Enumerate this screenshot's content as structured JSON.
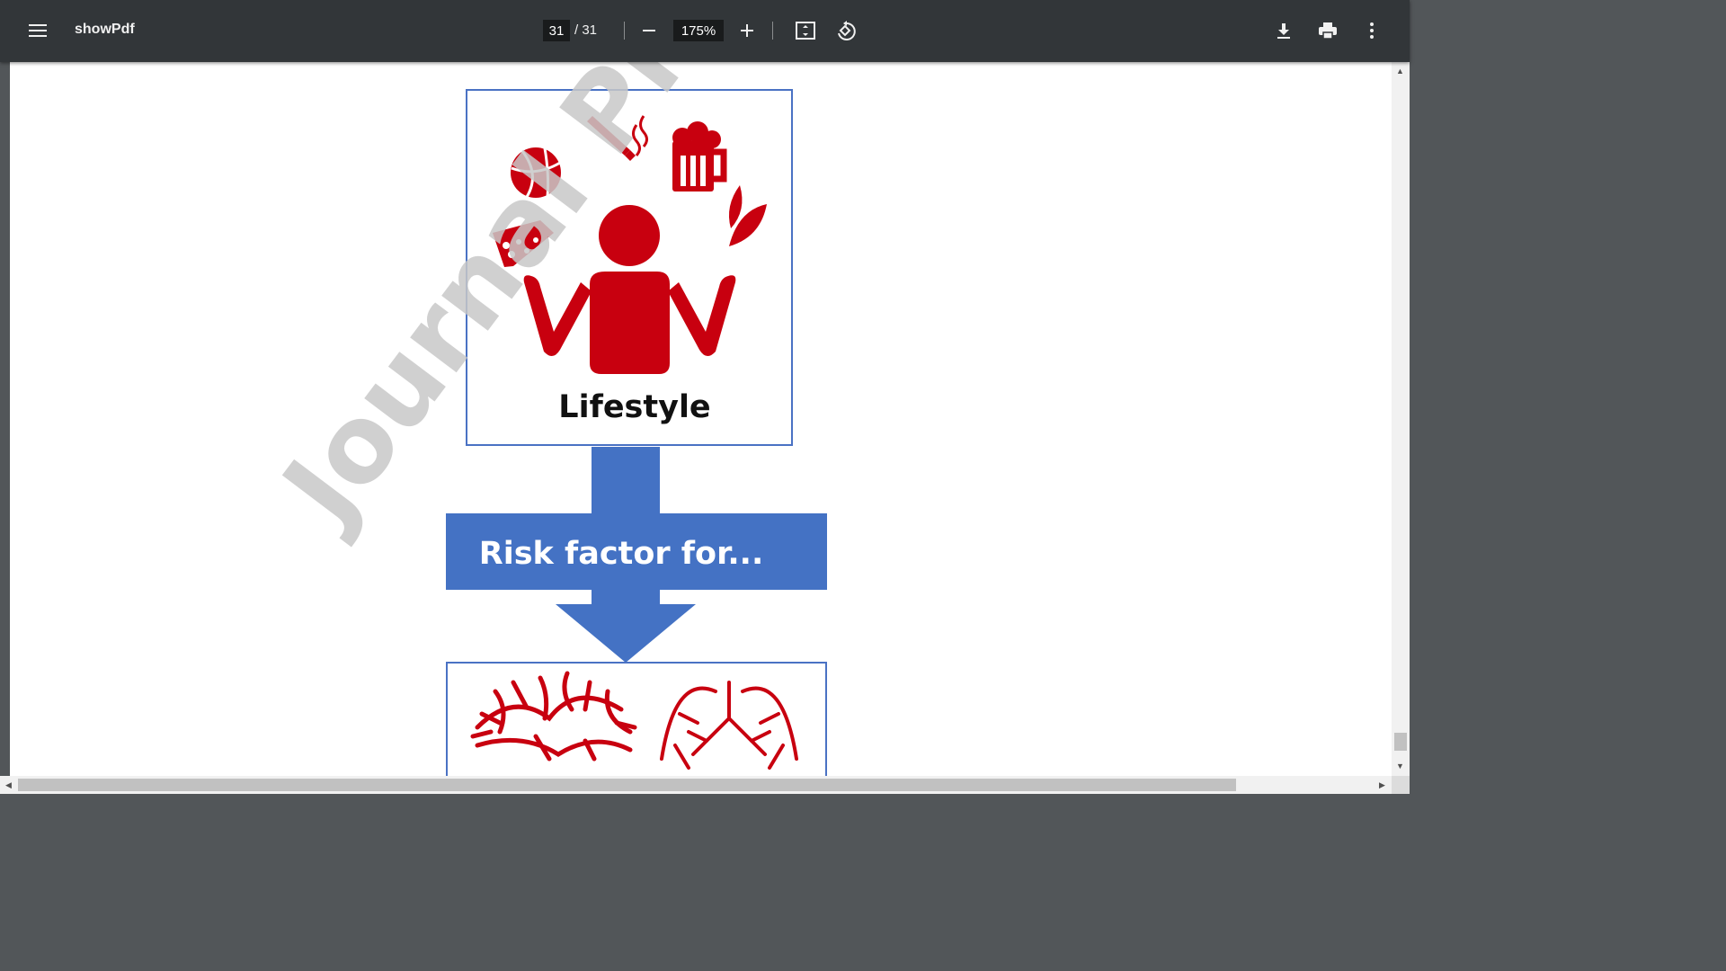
{
  "toolbar": {
    "title": "showPdf",
    "current_page": "31",
    "page_total": "/ 31",
    "zoom": "175%",
    "icons": [
      "menu-icon",
      "zoom-out-icon",
      "zoom-in-icon",
      "fit-page-icon",
      "rotate-icon",
      "download-icon",
      "print-icon",
      "more-options-icon"
    ]
  },
  "document": {
    "watermark": "Journal Pre",
    "box_label": "Lifestyle",
    "arrow_label": "Risk factor for...",
    "colors": {
      "icon_red": "#c8000f",
      "box_blue": "#4a72c4",
      "arrow_blue": "#4472c4",
      "watermark_gray": "#c8c8c8"
    },
    "lifestyle_icons": [
      "basketball-icon",
      "cigarette-icon",
      "beer-mug-icon",
      "leaf-icon",
      "cheese-icon",
      "person-shrugging-icon"
    ],
    "outcome_icons": [
      "brain-vessels-icon",
      "lungs-icon"
    ]
  }
}
